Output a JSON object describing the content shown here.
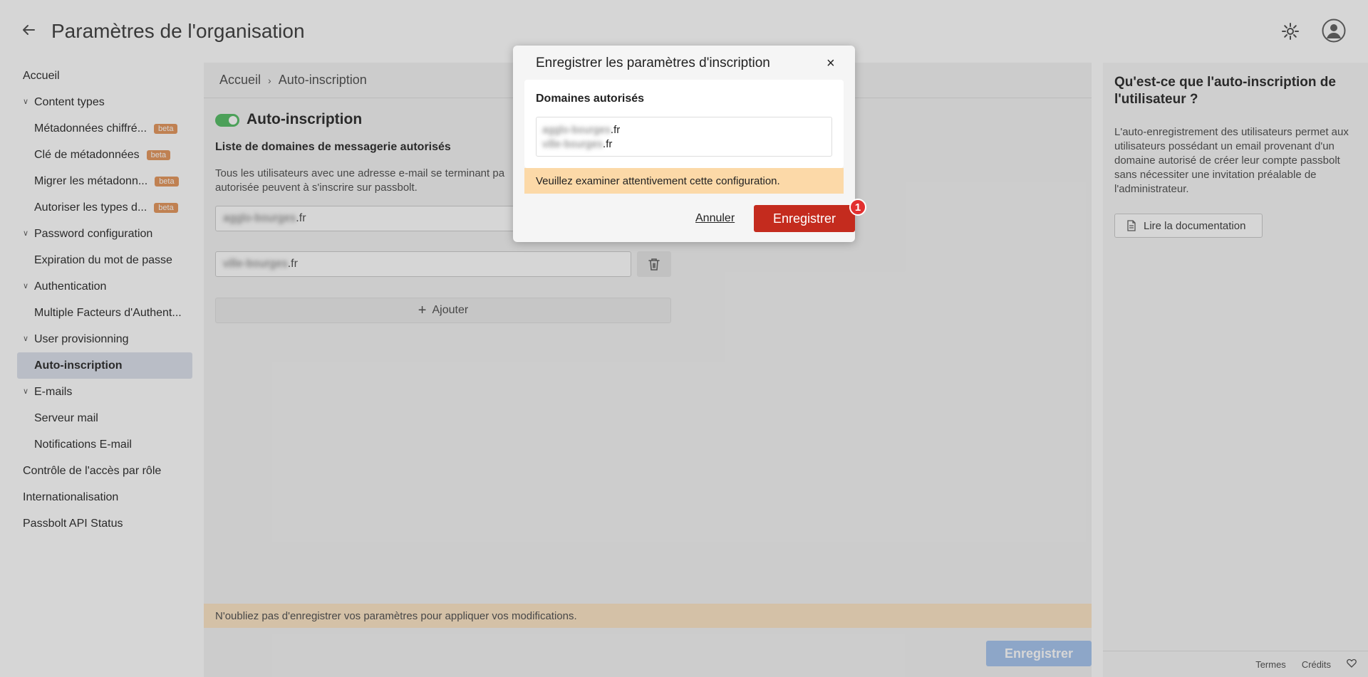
{
  "header": {
    "title": "Paramètres de l'organisation",
    "back_icon": "arrow-left-icon",
    "settings_icon": "gear-icon",
    "avatar_icon": "user-avatar-icon"
  },
  "sidebar": {
    "items": [
      {
        "label": "Accueil",
        "kind": "top"
      },
      {
        "label": "Content types",
        "kind": "group"
      },
      {
        "label": "Métadonnées chiffré...",
        "kind": "sub",
        "badge": "beta"
      },
      {
        "label": "Clé de métadonnées",
        "kind": "sub",
        "badge": "beta"
      },
      {
        "label": "Migrer les métadonn...",
        "kind": "sub",
        "badge": "beta"
      },
      {
        "label": "Autoriser les types d...",
        "kind": "sub",
        "badge": "beta"
      },
      {
        "label": "Password configuration",
        "kind": "group"
      },
      {
        "label": "Expiration du mot de passe",
        "kind": "sub"
      },
      {
        "label": "Authentication",
        "kind": "group"
      },
      {
        "label": "Multiple Facteurs d'Authent...",
        "kind": "sub"
      },
      {
        "label": "User provisionning",
        "kind": "group"
      },
      {
        "label": "Auto-inscription",
        "kind": "sub",
        "active": true
      },
      {
        "label": "E-mails",
        "kind": "group"
      },
      {
        "label": "Serveur mail",
        "kind": "sub"
      },
      {
        "label": "Notifications E-mail",
        "kind": "sub"
      },
      {
        "label": "Contrôle de l'accès par rôle",
        "kind": "top"
      },
      {
        "label": "Internationalisation",
        "kind": "top"
      },
      {
        "label": "Passbolt API Status",
        "kind": "top"
      }
    ]
  },
  "main": {
    "breadcrumb": [
      "Accueil",
      "Auto-inscription"
    ],
    "breadcrumb_sep": "›",
    "section_title": "Auto-inscription",
    "toggle_on": true,
    "domains_heading": "Liste de domaines de messagerie autorisés",
    "domains_desc": "Tous les utilisateurs avec une adresse e-mail se terminant pa... autorisée peuvent à s'inscrire sur passbolt.",
    "domains_desc_line1": "Tous les utilisateurs avec une adresse e-mail se terminant pa",
    "domains_desc_line2": "autorisée peuvent à s'inscrire sur passbolt.",
    "domains": [
      {
        "blurred": "agglo-bourges",
        "suffix": ".fr"
      },
      {
        "blurred": "ville-bourges",
        "suffix": ".fr"
      }
    ],
    "add_label": "Ajouter",
    "reminder": "N'oubliez pas d'enregistrer vos paramètres pour appliquer vos modifications.",
    "save_label": "Enregistrer"
  },
  "help": {
    "title": "Qu'est-ce que l'auto-inscription de l'utilisateur ?",
    "text": "L'auto-enregistrement des utilisateurs permet aux utilisateurs possédant un email provenant d'un domaine autorisé de créer leur compte passbolt sans nécessiter une invitation préalable de l'administrateur.",
    "doc_button": "Lire la documentation"
  },
  "footer": {
    "terms": "Termes",
    "credits": "Crédits"
  },
  "dialog": {
    "title": "Enregistrer les paramètres d'inscription",
    "close_icon": "×",
    "card_title": "Domaines autorisés",
    "domains": [
      {
        "blurred": "agglo-bourges",
        "suffix": ".fr"
      },
      {
        "blurred": "ville-bourges",
        "suffix": ".fr"
      }
    ],
    "warning": "Veuillez examiner attentivement cette configuration.",
    "cancel_label": "Annuler",
    "save_label": "Enregistrer",
    "step_badge": "1"
  },
  "colors": {
    "save_red": "#c42b1e",
    "warning_orange": "#fcd9a8",
    "toggle_green": "#5bbf6a",
    "beta_badge": "#e59a62",
    "save_disabled": "#a9c6ef"
  }
}
